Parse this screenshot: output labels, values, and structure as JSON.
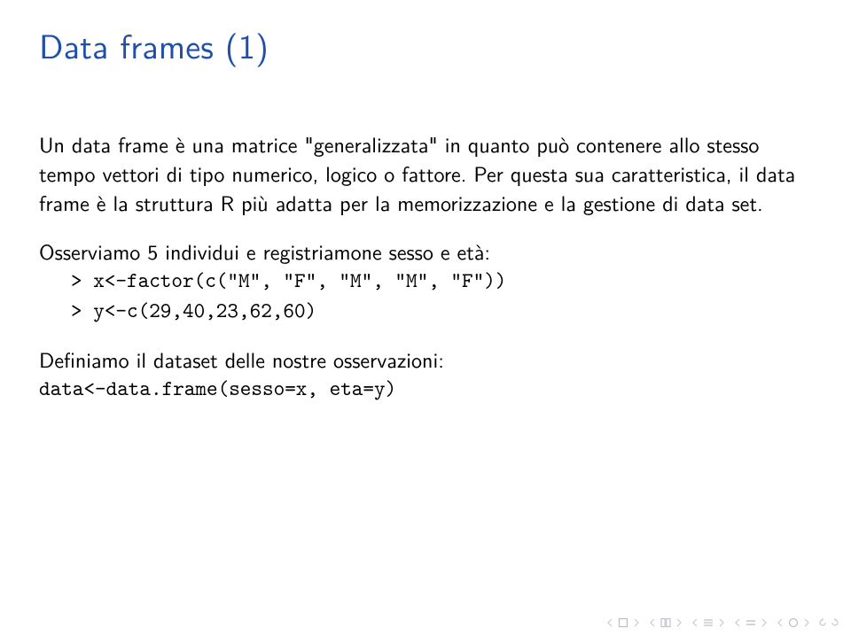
{
  "title": "Data frames (1)",
  "p1": "Un data frame è una matrice \"generalizzata\" in quanto può contenere allo stesso tempo vettori di tipo numerico, logico o fattore. Per questa sua caratteristica, il data frame è la struttura R più adatta per la memorizzazione e la gestione di data set.",
  "p2": "Osserviamo 5 individui e registriamone sesso e età:",
  "code1": "> x<-factor(c(\"M\", \"F\", \"M\", \"M\", \"F\"))",
  "code2": "> y<-c(29,40,23,62,60)",
  "p3": "Definiamo il dataset delle nostre osservazioni:",
  "code3": "data<-data.frame(sesso=x, eta=y)"
}
